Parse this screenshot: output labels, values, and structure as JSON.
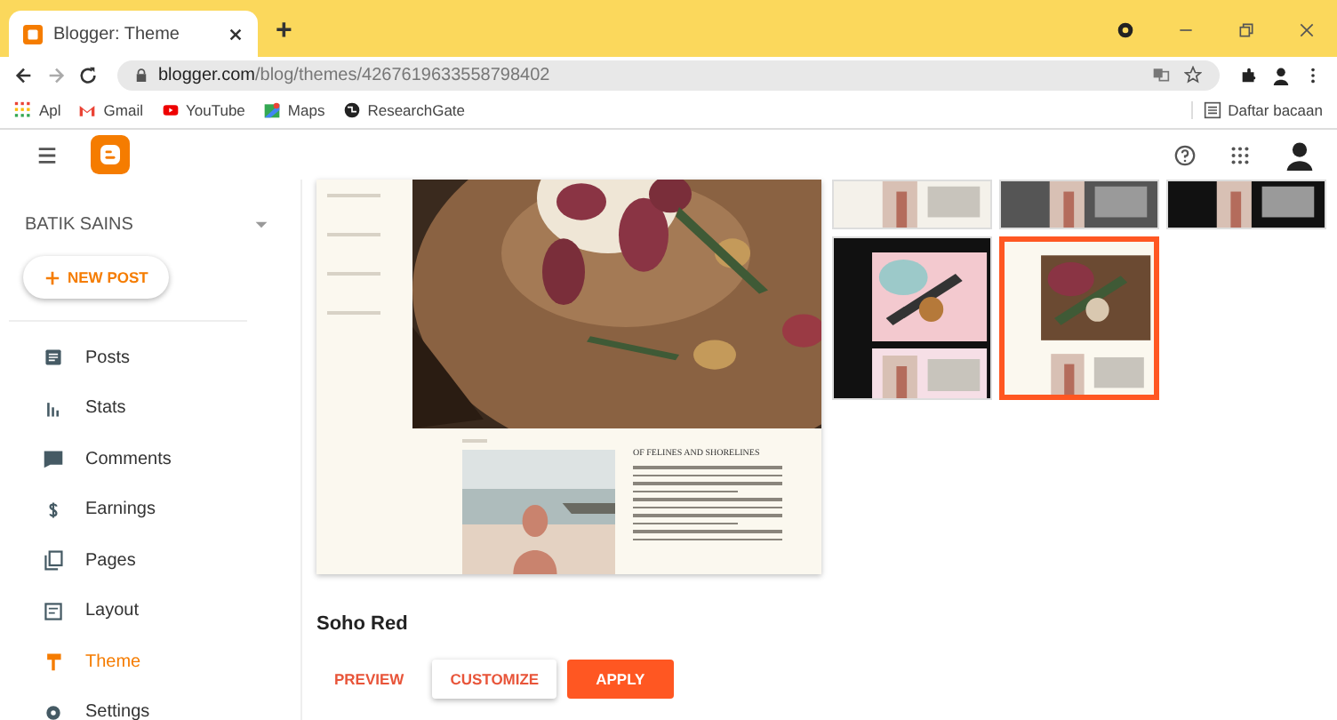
{
  "browser": {
    "tab_title": "Blogger: Theme",
    "new_tab": "+",
    "url_domain": "blogger.com",
    "url_path": "/blog/themes/4267619633558798402",
    "bookmarks": [
      {
        "label": "Apl",
        "kind": "apps"
      },
      {
        "label": "Gmail",
        "kind": "gmail"
      },
      {
        "label": "YouTube",
        "kind": "youtube"
      },
      {
        "label": "Maps",
        "kind": "maps"
      },
      {
        "label": "ResearchGate",
        "kind": "globe"
      }
    ],
    "reading_list": "Daftar bacaan"
  },
  "blog": {
    "name": "BATIK SAINS",
    "new_post": "NEW POST"
  },
  "sidebar": {
    "items": [
      {
        "label": "Posts",
        "kind": "posts",
        "selected": false
      },
      {
        "label": "Stats",
        "kind": "stats",
        "selected": false
      },
      {
        "label": "Comments",
        "kind": "comments",
        "selected": false
      },
      {
        "label": "Earnings",
        "kind": "earnings",
        "selected": false
      },
      {
        "label": "Pages",
        "kind": "pages",
        "selected": false
      },
      {
        "label": "Layout",
        "kind": "layout",
        "selected": false
      },
      {
        "label": "Theme",
        "kind": "theme",
        "selected": true
      },
      {
        "label": "Settings",
        "kind": "settings",
        "selected": false
      }
    ]
  },
  "preview": {
    "heading": "OF FELINES AND SHORELINES"
  },
  "themes": [
    {
      "kind": "light",
      "selected": false
    },
    {
      "kind": "gray",
      "selected": false
    },
    {
      "kind": "dark",
      "selected": false
    },
    {
      "kind": "pink",
      "selected": false
    },
    {
      "kind": "cream",
      "selected": true
    }
  ],
  "theme": {
    "name": "Soho Red",
    "buttons": [
      {
        "label": "PREVIEW",
        "kind": "text"
      },
      {
        "label": "CUSTOMIZE",
        "kind": "outlined"
      },
      {
        "label": "APPLY",
        "kind": "filled"
      }
    ]
  }
}
